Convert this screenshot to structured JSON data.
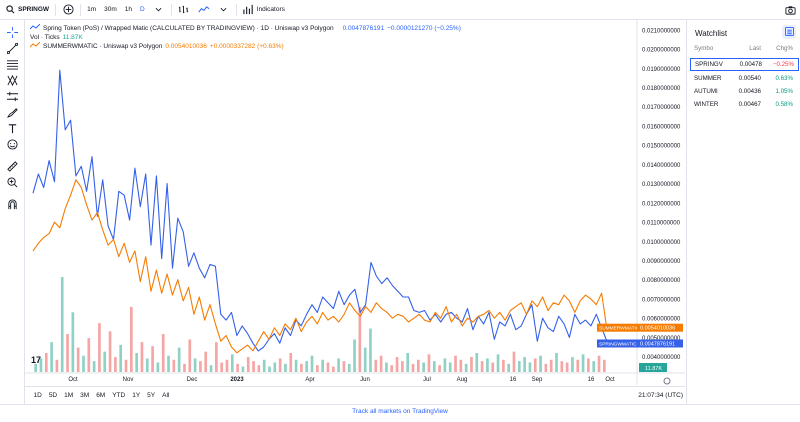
{
  "toolbar": {
    "symbol": "SPRINGW",
    "intervals": [
      "1m",
      "30m",
      "1h",
      "D"
    ],
    "active_interval": "D",
    "indicators_label": "Indicators"
  },
  "legend": {
    "title": "Spring Token (PoS) / Wrapped Matic (CALCULATED BY TRADINGVIEW) · 1D · Uniswap v3 Polygon",
    "main_value": "0.0047876191",
    "main_change": "−0.0000121270 (−0.25%)",
    "vol_label": "Vol · Ticks",
    "vol_value": "11.87K",
    "compare_symbol": "SUMMERWMATIC · Uniswap v3 Polygon",
    "compare_value": "0.0054010036",
    "compare_change": "+0.0000337282 (+0.63%)"
  },
  "colors": {
    "main_series": "#3561e8",
    "compare_series": "#f57c00",
    "vol_up": "#26a69a",
    "vol_down": "#ef5350",
    "accent": "#2962ff"
  },
  "chart_data": {
    "type": "line",
    "x_ticks": [
      "Oct",
      "Nov",
      "Dec",
      "2023",
      "Apr",
      "Jun",
      "Jul",
      "Aug",
      "16",
      "Sep",
      "16",
      "Oct",
      "16"
    ],
    "y_ticks": [
      "0.0210000000",
      "0.0200000000",
      "0.0190000000",
      "0.0180000000",
      "0.0170000000",
      "0.0160000000",
      "0.0150000000",
      "0.0140000000",
      "0.0130000000",
      "0.0120000000",
      "0.0110000000",
      "0.0100000000",
      "0.0090000000",
      "0.0080000000",
      "0.0070000000",
      "0.0060000000",
      "0.0050000000",
      "0.0040000000"
    ],
    "ylim": [
      0.0032,
      0.0212
    ],
    "series": [
      {
        "values": [
          0.0125,
          0.0135,
          0.0128,
          0.0142,
          0.0131,
          0.0189,
          0.0158,
          0.0163,
          0.0134,
          0.0139,
          0.0126,
          0.0144,
          0.0113,
          0.0132,
          0.0108,
          0.0101,
          0.0126,
          0.0124,
          0.0111,
          0.0138,
          0.0118,
          0.0135,
          0.0098,
          0.0134,
          0.0091,
          0.013,
          0.0086,
          0.0112,
          0.0105,
          0.0087,
          0.0094,
          0.0086,
          0.0081,
          0.0088,
          0.0087,
          0.0062,
          0.0059,
          0.0063,
          0.0051,
          0.0056,
          0.0052,
          0.0047,
          0.0043,
          0.0045,
          0.0049,
          0.0052,
          0.0047,
          0.0055,
          0.0051,
          0.0059,
          0.0056,
          0.0062,
          0.0067,
          0.0063,
          0.0071,
          0.0068,
          0.0065,
          0.0074,
          0.0067,
          0.0072,
          0.0075,
          0.0063,
          0.0067,
          0.0089,
          0.0082,
          0.0078,
          0.0081,
          0.0077,
          0.0074,
          0.0071,
          0.0071,
          0.0064,
          0.0063,
          0.0064,
          0.0059,
          0.0062,
          0.0058,
          0.0062,
          0.0063,
          0.006,
          0.0058,
          0.0065,
          0.0054,
          0.0061,
          0.0057,
          0.0063,
          0.0049,
          0.0058,
          0.0056,
          0.0062,
          0.0054,
          0.0056,
          0.0062,
          0.0067,
          0.0048,
          0.006,
          0.0055,
          0.0053,
          0.0061,
          0.0057,
          0.005,
          0.0062,
          0.0057,
          0.0059,
          0.0056,
          0.0062,
          0.0055,
          0.0047876191
        ]
      },
      {
        "values": [
          0.0095,
          0.0099,
          0.0102,
          0.0104,
          0.011,
          0.0107,
          0.0117,
          0.0124,
          0.0132,
          0.0128,
          0.0119,
          0.0111,
          0.0115,
          0.0106,
          0.0098,
          0.0101,
          0.0092,
          0.0099,
          0.0089,
          0.0095,
          0.0079,
          0.0092,
          0.0074,
          0.0085,
          0.0073,
          0.0083,
          0.0072,
          0.008,
          0.0069,
          0.0076,
          0.0062,
          0.0071,
          0.0059,
          0.0067,
          0.0057,
          0.0048,
          0.0051,
          0.0045,
          0.0042,
          0.0044,
          0.0046,
          0.0043,
          0.0048,
          0.0053,
          0.0049,
          0.0055,
          0.0051,
          0.0057,
          0.0054,
          0.006,
          0.0053,
          0.0058,
          0.0061,
          0.0057,
          0.0063,
          0.0059,
          0.0061,
          0.0058,
          0.0062,
          0.0068,
          0.0064,
          0.0061,
          0.0066,
          0.0063,
          0.0068,
          0.0065,
          0.0063,
          0.006,
          0.0062,
          0.0061,
          0.0058,
          0.006,
          0.0062,
          0.0059,
          0.0058,
          0.0063,
          0.006,
          0.0066,
          0.0058,
          0.0062,
          0.0056,
          0.006,
          0.0058,
          0.0061,
          0.0062,
          0.0064,
          0.006,
          0.0063,
          0.0059,
          0.0064,
          0.0066,
          0.0068,
          0.0062,
          0.0069,
          0.0066,
          0.0071,
          0.0064,
          0.0068,
          0.0067,
          0.0072,
          0.0069,
          0.0063,
          0.0069,
          0.0072,
          0.007,
          0.0067,
          0.0073,
          0.0054010036
        ]
      }
    ],
    "volume": [
      6,
      10,
      14,
      22,
      9,
      70,
      28,
      44,
      18,
      12,
      25,
      8,
      36,
      15,
      30,
      11,
      20,
      9,
      48,
      14,
      22,
      10,
      19,
      7,
      28,
      12,
      9,
      18,
      6,
      24,
      10,
      8,
      15,
      5,
      22,
      7,
      9,
      13,
      6,
      4,
      11,
      8,
      5,
      9,
      4,
      7,
      10,
      6,
      14,
      9,
      6,
      8,
      12,
      5,
      9,
      7,
      4,
      10,
      8,
      6,
      24,
      48,
      18,
      32,
      9,
      12,
      7,
      5,
      11,
      8,
      14,
      6,
      9,
      7,
      13,
      8,
      5,
      10,
      7,
      12,
      9,
      6,
      11,
      14,
      8,
      10,
      7,
      13,
      9,
      6,
      15,
      8,
      11,
      7,
      10,
      12,
      6,
      9,
      14,
      8,
      7,
      11,
      9,
      13,
      10,
      8,
      12,
      9
    ],
    "last_labels": [
      {
        "name": "SUMMERWMATIC",
        "value": "0.0054010036"
      },
      {
        "name": "SPRINGWMATIC",
        "value": "0.0047876191"
      }
    ],
    "volume_label": "11.87K"
  },
  "bottom": {
    "ranges": [
      "1D",
      "5D",
      "1M",
      "3M",
      "6M",
      "YTD",
      "1Y",
      "5Y",
      "All"
    ],
    "clock": "21:07:34 (UTC)"
  },
  "watchlist": {
    "title": "Watchlist",
    "headers": {
      "symbol": "Symbo",
      "last": "Last",
      "chg": "Chg%"
    },
    "rows": [
      {
        "symbol": "SPRINGV",
        "last": "0.00478",
        "chg": "−0.25%",
        "dir": "neg",
        "selected": true
      },
      {
        "symbol": "SUMMER",
        "last": "0.00540",
        "chg": "0.63%",
        "dir": "pos",
        "selected": false
      },
      {
        "symbol": "AUTUMI",
        "last": "0.00436",
        "chg": "1.05%",
        "dir": "pos",
        "selected": false
      },
      {
        "symbol": "WINTER",
        "last": "0.00467",
        "chg": "0.58%",
        "dir": "pos",
        "selected": false
      }
    ]
  },
  "footer": {
    "link": "Track all markets on TradingView"
  }
}
